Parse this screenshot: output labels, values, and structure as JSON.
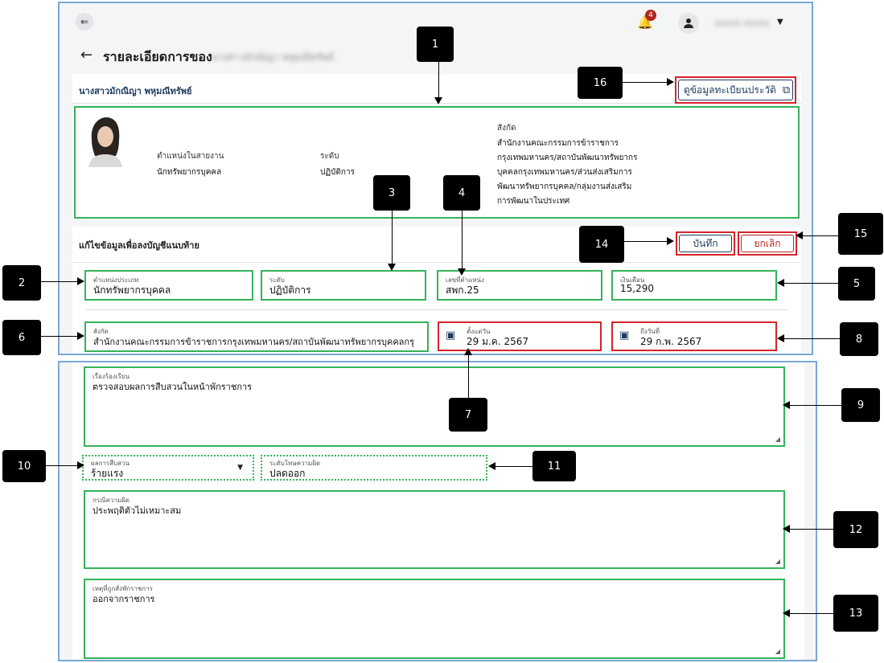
{
  "header": {
    "notification_count": "4",
    "username_masked": "xxxxx xxxxx",
    "page_title": "รายละเอียดการของ",
    "page_title_name_masked": "นางสาวมักณิญา พหุมณีทรัพย์"
  },
  "profile": {
    "name": "นางสาวมักณิญา พหุมณีทรัพย์",
    "view_history_link": "ดูข้อมูลทะเบียนประวัติ",
    "position_label": "ตำแหน่งในสายงาน",
    "position_value": "นักทรัพยากรบุคคล",
    "level_label": "ระดับ",
    "level_value": "ปฏิบัติการ",
    "affiliation_label": "สังกัด",
    "affiliation_lines": [
      "สำนักงานคณะกรรมการข้าราชการ",
      "กรุงเทพมหานคร/สถาบันพัฒนาทรัพยากร",
      "บุคคลกรุงเทพมหานคร/ส่วนส่งเสริมการ",
      "พัฒนาทรัพยากรบุคคล/กลุ่มงานส่งเสริม",
      "การพัฒนาในประเทศ"
    ]
  },
  "edit_section": {
    "title": "แก้ไขข้อมูลเพื่อลงบัญชีแนบท้าย",
    "save_label": "บันทึก",
    "cancel_label": "ยกเลิก"
  },
  "fields": {
    "position_type": {
      "label": "ตำแหน่งประเภท",
      "value": "นักทรัพยากรบุคคล"
    },
    "level": {
      "label": "ระดับ",
      "value": "ปฏิบัติการ"
    },
    "position_number": {
      "label": "เลขที่ตำแหน่ง",
      "value": "สพก.25"
    },
    "salary": {
      "label": "เงินเดือน",
      "value": "15,290"
    },
    "affiliation": {
      "label": "สังกัด",
      "value": "สำนักงานคณะกรรมการข้าราชการกรุงเทพมหานคร/สถาบันพัฒนาทรัพยากรบุคคลกรุ"
    },
    "start_date": {
      "label": "ตั้งแต่วัน",
      "value": "29 ม.ค. 2567"
    },
    "end_date": {
      "label": "ถึงวันที่",
      "value": "29 ก.พ. 2567"
    },
    "subject": {
      "label": "เรื่องร้องเรียน",
      "value": "ตรวจสอบผลการสืบสวนในหน้าพักราชการ"
    },
    "investigation_result": {
      "label": "ผลการสืบสวน",
      "value": "ร้ายแรง"
    },
    "penalty_level": {
      "label": "ระดับโทษความผิด",
      "value": "ปลดออก"
    },
    "offense": {
      "label": "กรณีความผิด",
      "value": "ประพฤติตัวไม่เหมาะสม"
    },
    "suspension_reason": {
      "label": "เหตุที่ถูกสั่งพักราชการ",
      "value": "ออกจากราชการ"
    }
  },
  "callouts": [
    "1",
    "2",
    "3",
    "4",
    "5",
    "6",
    "7",
    "8",
    "9",
    "10",
    "11",
    "12",
    "13",
    "14",
    "15",
    "16"
  ],
  "colors": {
    "highlight_green": "#35b35a",
    "highlight_red": "#d6232a",
    "frame_blue": "#7aa7d6",
    "brand_dark": "#1b3a5c",
    "badge_red": "#b3261e"
  },
  "icons": [
    "menu-collapse-icon",
    "bell-icon",
    "user-icon",
    "chevron-down-icon",
    "back-arrow-icon",
    "external-link-icon",
    "calendar-icon",
    "dropdown-arrow-icon",
    "avatar-photo"
  ]
}
